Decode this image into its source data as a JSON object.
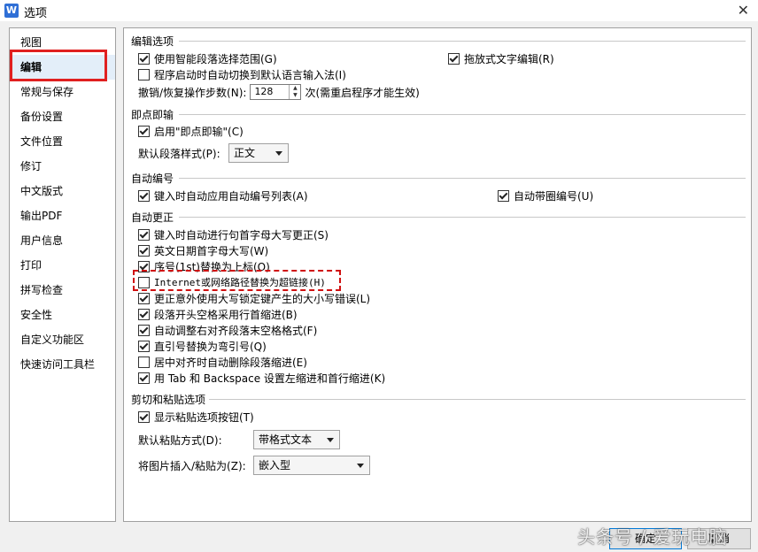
{
  "window": {
    "title": "选项",
    "app_icon_letter": "W",
    "close_glyph": "✕"
  },
  "sidebar": {
    "items": [
      {
        "label": "视图"
      },
      {
        "label": "编辑"
      },
      {
        "label": "常规与保存"
      },
      {
        "label": "备份设置"
      },
      {
        "label": "文件位置"
      },
      {
        "label": "修订"
      },
      {
        "label": "中文版式"
      },
      {
        "label": "输出PDF"
      },
      {
        "label": "用户信息"
      },
      {
        "label": "打印"
      },
      {
        "label": "拼写检查"
      },
      {
        "label": "安全性"
      },
      {
        "label": "自定义功能区"
      },
      {
        "label": "快速访问工具栏"
      }
    ]
  },
  "edit_options": {
    "title": "编辑选项",
    "smart_select": {
      "label": "使用智能段落选择范围(G)",
      "checked": true
    },
    "drag_drop": {
      "label": "拖放式文字编辑(R)",
      "checked": true
    },
    "auto_ime": {
      "label": "程序启动时自动切换到默认语言输入法(I)",
      "checked": false
    },
    "undo_label": "撤销/恢复操作步数(N):",
    "undo_value": "128",
    "undo_suffix": "次(需重启程序才能生效)"
  },
  "click_type": {
    "title": "即点即输",
    "enable": {
      "label": "启用\"即点即输\"(C)",
      "checked": true
    },
    "default_style_label": "默认段落样式(P):",
    "default_style_value": "正文"
  },
  "auto_number": {
    "title": "自动编号",
    "list": {
      "label": "键入时自动应用自动编号列表(A)",
      "checked": true
    },
    "circle": {
      "label": "自动带圈编号(U)",
      "checked": true
    }
  },
  "auto_correct": {
    "title": "自动更正",
    "items": [
      {
        "label": "键入时自动进行句首字母大写更正(S)",
        "checked": true
      },
      {
        "label": "英文日期首字母大写(W)",
        "checked": true
      },
      {
        "label": "序号(1st)替换为上标(O)",
        "checked": true
      },
      {
        "label": "Internet或网络路径替换为超链接(H)",
        "checked": false
      },
      {
        "label": "更正意外使用大写锁定键产生的大小写错误(L)",
        "checked": true
      },
      {
        "label": "段落开头空格采用行首缩进(B)",
        "checked": true
      },
      {
        "label": "自动调整右对齐段落末空格格式(F)",
        "checked": true
      },
      {
        "label": "直引号替换为弯引号(Q)",
        "checked": true
      },
      {
        "label": "居中对齐时自动删除段落缩进(E)",
        "checked": false
      },
      {
        "label": "用 Tab 和 Backspace 设置左缩进和首行缩进(K)",
        "checked": true
      }
    ]
  },
  "paste": {
    "title": "剪切和粘贴选项",
    "show_button": {
      "label": "显示粘贴选项按钮(T)",
      "checked": true
    },
    "default_mode_label": "默认粘贴方式(D):",
    "default_mode_value": "带格式文本",
    "image_label": "将图片插入/粘贴为(Z):",
    "image_value": "嵌入型"
  },
  "buttons": {
    "ok": "确定",
    "cancel": "取消"
  },
  "watermark": "头条号 / 爱玩电脑",
  "colors": {
    "highlight_red": "#e02020",
    "accent": "#2f6fd6"
  }
}
